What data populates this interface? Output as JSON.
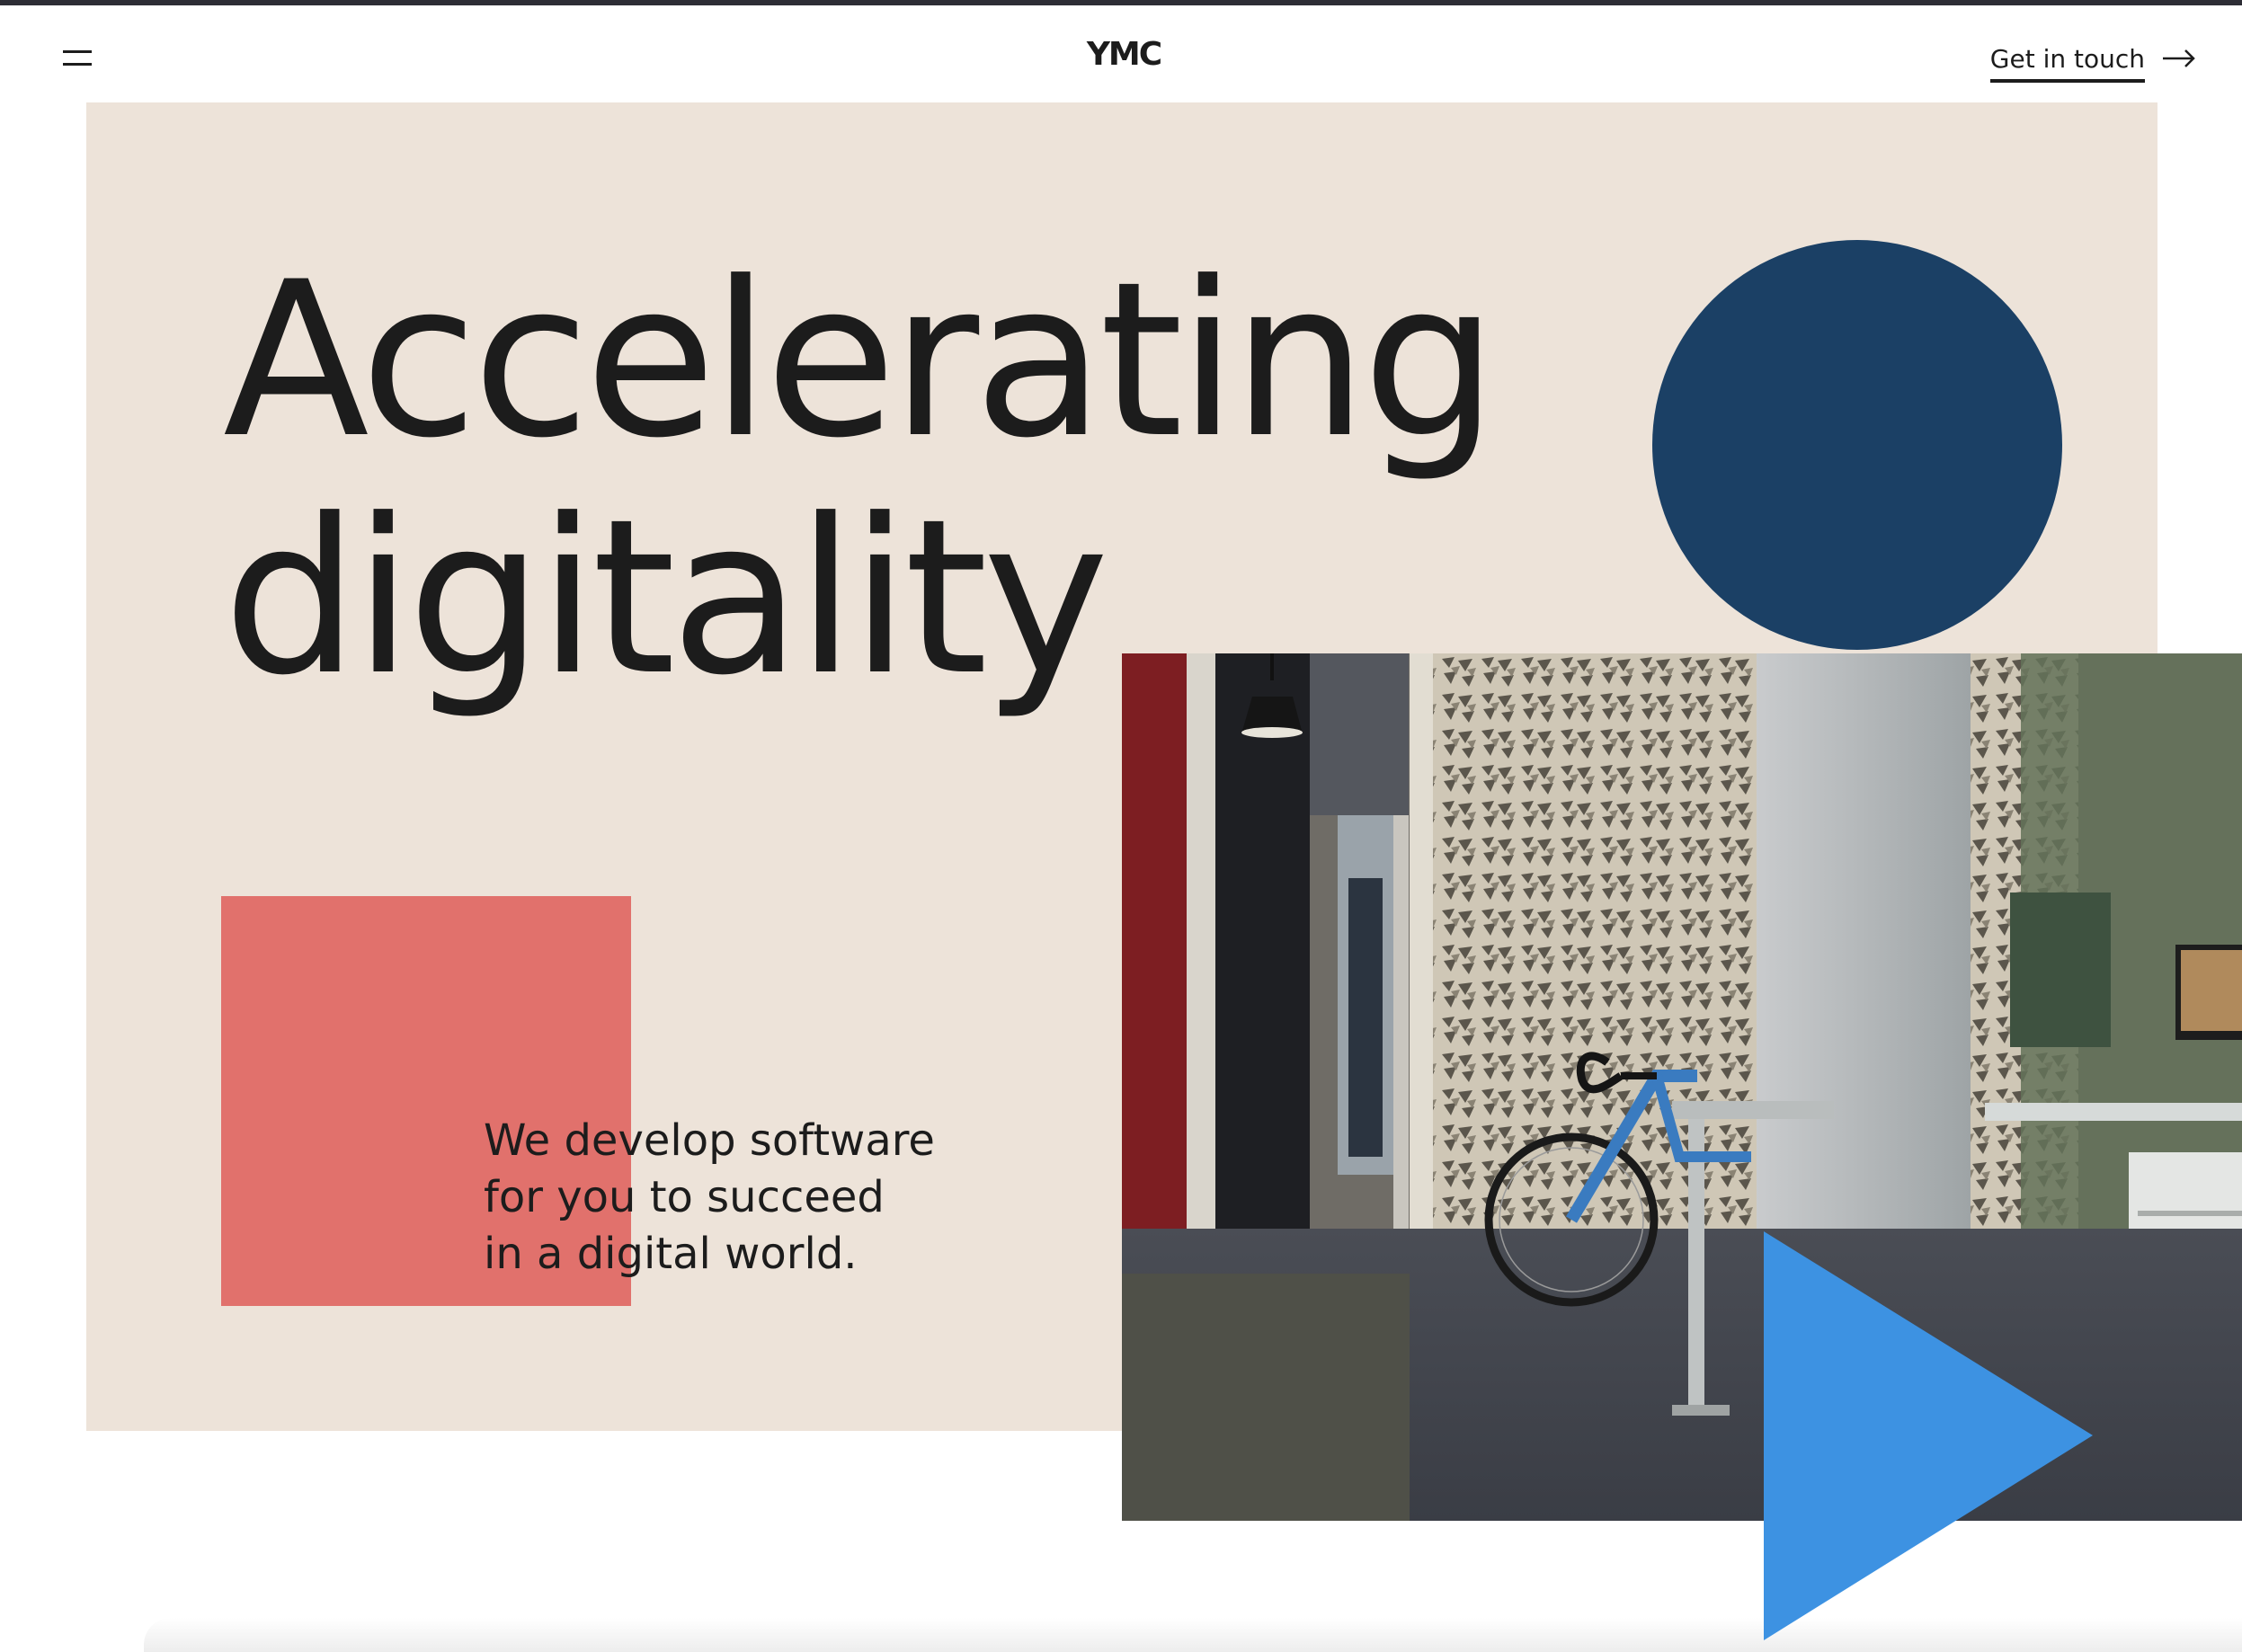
{
  "header": {
    "menu_icon": "hamburger-menu-icon",
    "logo_text": "YMC",
    "cta_label": "Get in touch",
    "cta_icon": "arrow-right-icon"
  },
  "hero": {
    "headline_line1": "Accelerating",
    "headline_line2": "digitality",
    "tagline_line1": "We develop software",
    "tagline_line2": "for you to succeed",
    "tagline_line3": "in a digital world.",
    "play_icon": "play-icon"
  },
  "colors": {
    "hero_background": "#ede3d9",
    "circle": "#1b4065",
    "square": "#e1716c",
    "play_triangle": "#3d92e2",
    "text": "#1c1c1c"
  }
}
